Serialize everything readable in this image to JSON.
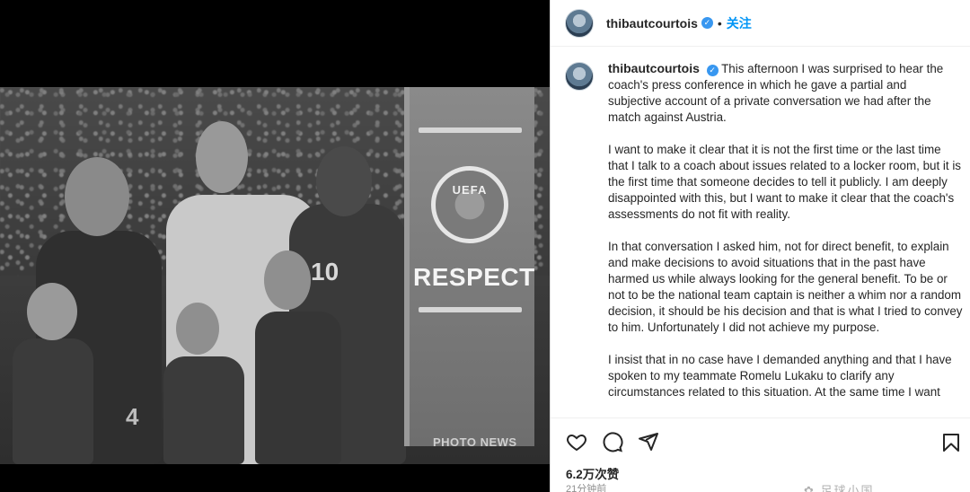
{
  "post": {
    "username": "thibautcourtois",
    "verified_mark": "✓",
    "follow_label": "关注",
    "photo": {
      "board_logo_text": "UEFA",
      "board_text": "RESPECT",
      "credit": "PHOTO NEWS",
      "jersey_numbers": [
        "10",
        "4"
      ]
    }
  },
  "caption": {
    "paragraphs": [
      "This afternoon I was surprised to hear the coach's press conference in which he gave a partial and subjective account of a private conversation we had after the match against Austria.",
      "I want to make it clear that it is not the first time or the last time that I talk to a coach about issues related to a locker room, but it is the first time that someone decides to tell it publicly. I am deeply disappointed with this, but I want to make it clear that the coach's assessments do not fit with reality.",
      "In that conversation I asked him, not for direct benefit, to explain and make decisions to avoid situations that in the past have harmed us while always looking for the general benefit. To be or not to be the national team captain is neither a whim nor a random decision, it should be his decision and that is what I tried to convey to him. Unfortunately I did not achieve my purpose.",
      "I insist that in no case have I demanded anything and that I have spoken to my teammate Romelu Lukaku to clarify any circumstances related to this situation. At the same time I want"
    ]
  },
  "actions": {
    "icons": [
      "heart-icon",
      "comment-icon",
      "share-icon",
      "bookmark-icon"
    ]
  },
  "stats": {
    "likes": "6.2万次赞",
    "time_ago": "21分钟前"
  },
  "watermark": "✿ 足球小国"
}
